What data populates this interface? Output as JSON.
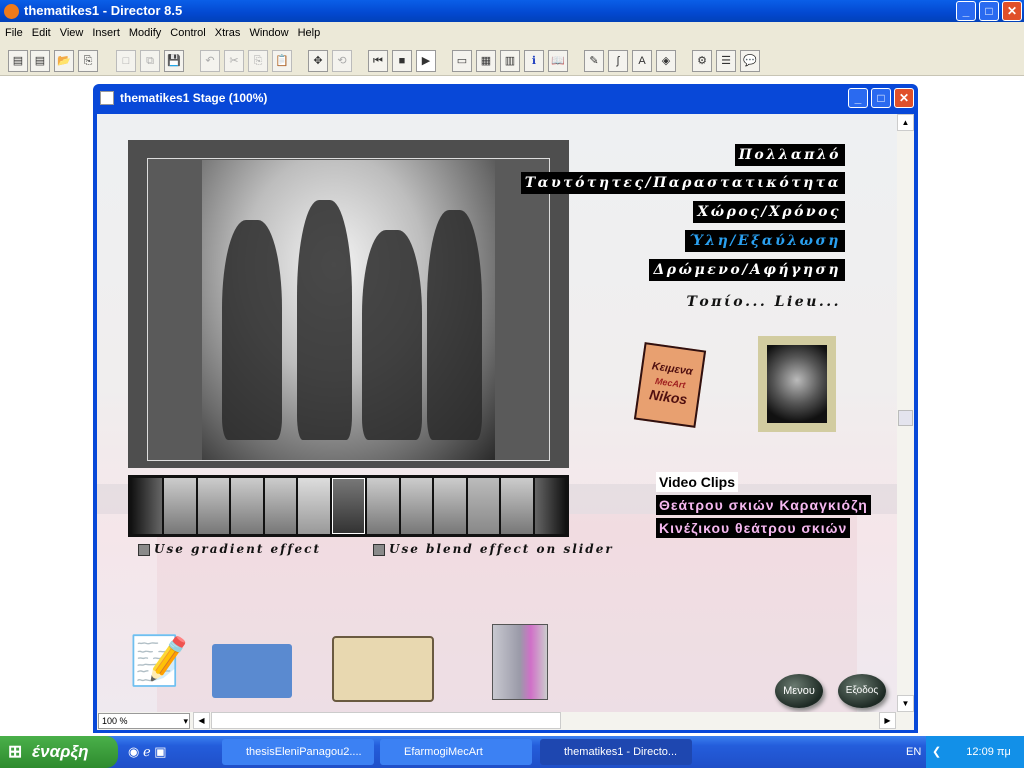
{
  "app": {
    "title": "thematikes1 - Director 8.5",
    "menu": [
      "File",
      "Edit",
      "View",
      "Insert",
      "Modify",
      "Control",
      "Xtras",
      "Window",
      "Help"
    ]
  },
  "stage": {
    "title": "thematikes1 Stage (100%)",
    "zoom": "100 %"
  },
  "content": {
    "menu_items": [
      {
        "label": "Πολλαπλό",
        "color": "#ffffff"
      },
      {
        "label": "Ταυτότητες/Παραστατικότητα",
        "color": "#ffffff"
      },
      {
        "label": "Χώρος/Χρόνος",
        "color": "#ffffff"
      },
      {
        "label": "Ύλη/Εξαύλωση",
        "color": "#2aa0f0"
      },
      {
        "label": "Δρώμενο/Αφήγηση",
        "color": "#ffffff"
      }
    ],
    "topio": "Τοπίο... Lieu...",
    "scroll_doc": {
      "lines": [
        "Κειμενα",
        "MecArt",
        "Nikos"
      ]
    },
    "checkbox_gradient": "Use gradient effect",
    "checkbox_blend": "Use blend effect on slider",
    "video_clips": {
      "title": "Video Clips",
      "items": [
        "Θεάτρου σκιών Καραγκιόζη",
        "Κινέζικου θεάτρου σκιών"
      ]
    },
    "menu_button": "Μενου",
    "exit_button": "Εξοδος"
  },
  "taskbar": {
    "start": "έναρξη",
    "tasks": [
      "thesisEleniPanagou2....",
      "EfarmogiMecArt",
      "thematikes1 - Directo..."
    ],
    "lang": "EN",
    "time": "12:09 πμ"
  }
}
